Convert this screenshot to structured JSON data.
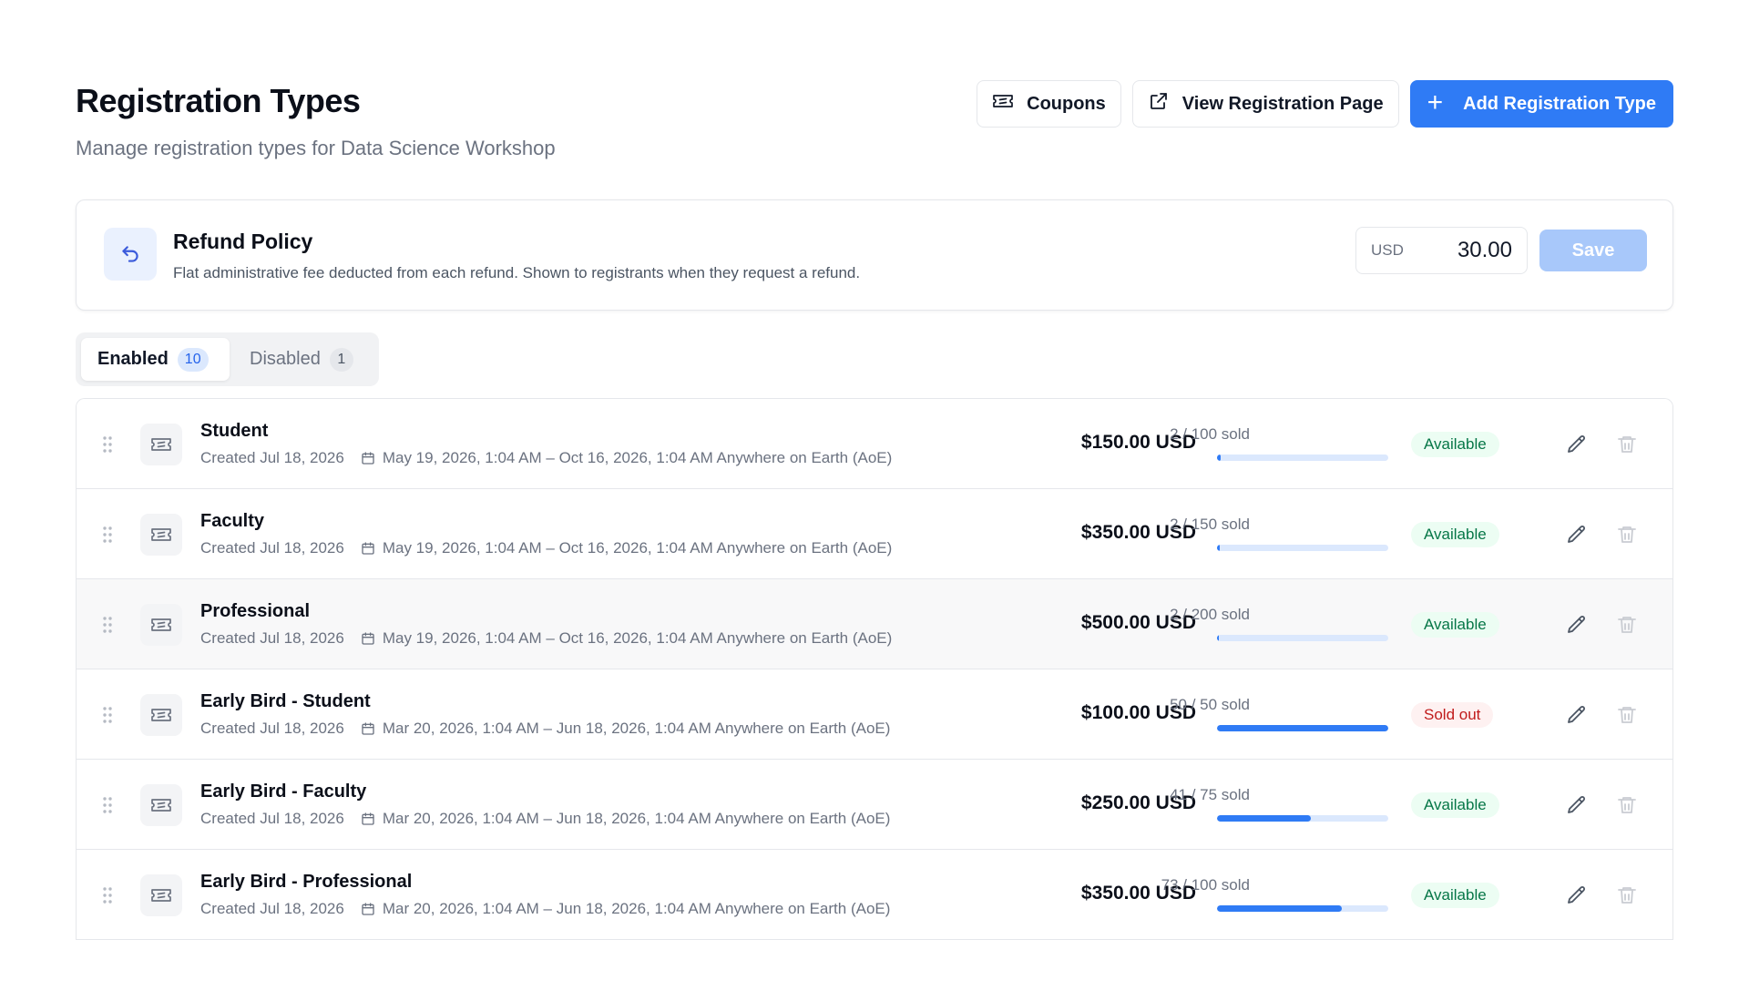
{
  "header": {
    "title": "Registration Types",
    "subtitle": "Manage registration types for Data Science Workshop",
    "coupons_label": "Coupons",
    "view_page_label": "View Registration Page",
    "add_label": "Add Registration Type"
  },
  "refund": {
    "title": "Refund Policy",
    "description": "Flat administrative fee deducted from each refund. Shown to registrants when they request a refund.",
    "currency": "USD",
    "amount": "30.00",
    "save_label": "Save"
  },
  "tabs": [
    {
      "label": "Enabled",
      "count": "10",
      "active": true
    },
    {
      "label": "Disabled",
      "count": "1",
      "active": false
    }
  ],
  "rows": [
    {
      "name": "Student",
      "created": "Created Jul 18, 2026",
      "dates": "May 19, 2026, 1:04 AM – Oct 16, 2026, 1:04 AM Anywhere on Earth (AoE)",
      "price": "$150.00 USD",
      "sold": "2 / 100 sold",
      "sold_fraction": 0.02,
      "status": "Available"
    },
    {
      "name": "Faculty",
      "created": "Created Jul 18, 2026",
      "dates": "May 19, 2026, 1:04 AM – Oct 16, 2026, 1:04 AM Anywhere on Earth (AoE)",
      "price": "$350.00 USD",
      "sold": "2 / 150 sold",
      "sold_fraction": 0.0133,
      "status": "Available"
    },
    {
      "name": "Professional",
      "created": "Created Jul 18, 2026",
      "dates": "May 19, 2026, 1:04 AM – Oct 16, 2026, 1:04 AM Anywhere on Earth (AoE)",
      "price": "$500.00 USD",
      "sold": "2 / 200 sold",
      "sold_fraction": 0.01,
      "status": "Available"
    },
    {
      "name": "Early Bird - Student",
      "created": "Created Jul 18, 2026",
      "dates": "Mar 20, 2026, 1:04 AM – Jun 18, 2026, 1:04 AM Anywhere on Earth (AoE)",
      "price": "$100.00 USD",
      "sold": "50 / 50 sold",
      "sold_fraction": 1.0,
      "status": "Sold out"
    },
    {
      "name": "Early Bird - Faculty",
      "created": "Created Jul 18, 2026",
      "dates": "Mar 20, 2026, 1:04 AM – Jun 18, 2026, 1:04 AM Anywhere on Earth (AoE)",
      "price": "$250.00 USD",
      "sold": "41 / 75 sold",
      "sold_fraction": 0.5467,
      "status": "Available"
    },
    {
      "name": "Early Bird - Professional",
      "created": "Created Jul 18, 2026",
      "dates": "Mar 20, 2026, 1:04 AM – Jun 18, 2026, 1:04 AM Anywhere on Earth (AoE)",
      "price": "$350.00 USD",
      "sold": "73 / 100 sold",
      "sold_fraction": 0.73,
      "status": "Available"
    }
  ],
  "colors": {
    "accent": "#2f7bf5",
    "available_bg": "#ecfdf3",
    "available_text": "#067647",
    "soldout_bg": "#fef1f1",
    "soldout_text": "#c01b1b"
  },
  "icons": {
    "coupons": "ticket-icon",
    "view_page": "external-link-icon",
    "add": "plus-icon",
    "refund": "undo-arrow-icon",
    "row": "ticket-icon",
    "calendar": "calendar-icon",
    "edit": "pencil-icon",
    "delete": "trash-icon",
    "drag": "drag-handle-icon"
  }
}
